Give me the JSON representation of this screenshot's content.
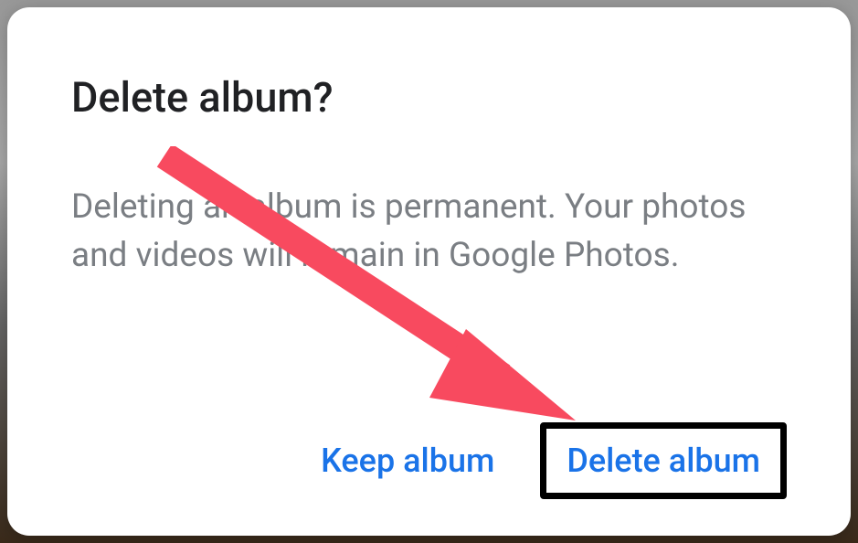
{
  "dialog": {
    "title": "Delete album?",
    "body": "Deleting an album is permanent. Your photos and videos will remain in Google Photos.",
    "actions": {
      "keep_label": "Keep album",
      "delete_label": "Delete album"
    }
  },
  "annotation": {
    "arrow_color": "#f84a5f",
    "highlight_target": "delete-album-button"
  }
}
